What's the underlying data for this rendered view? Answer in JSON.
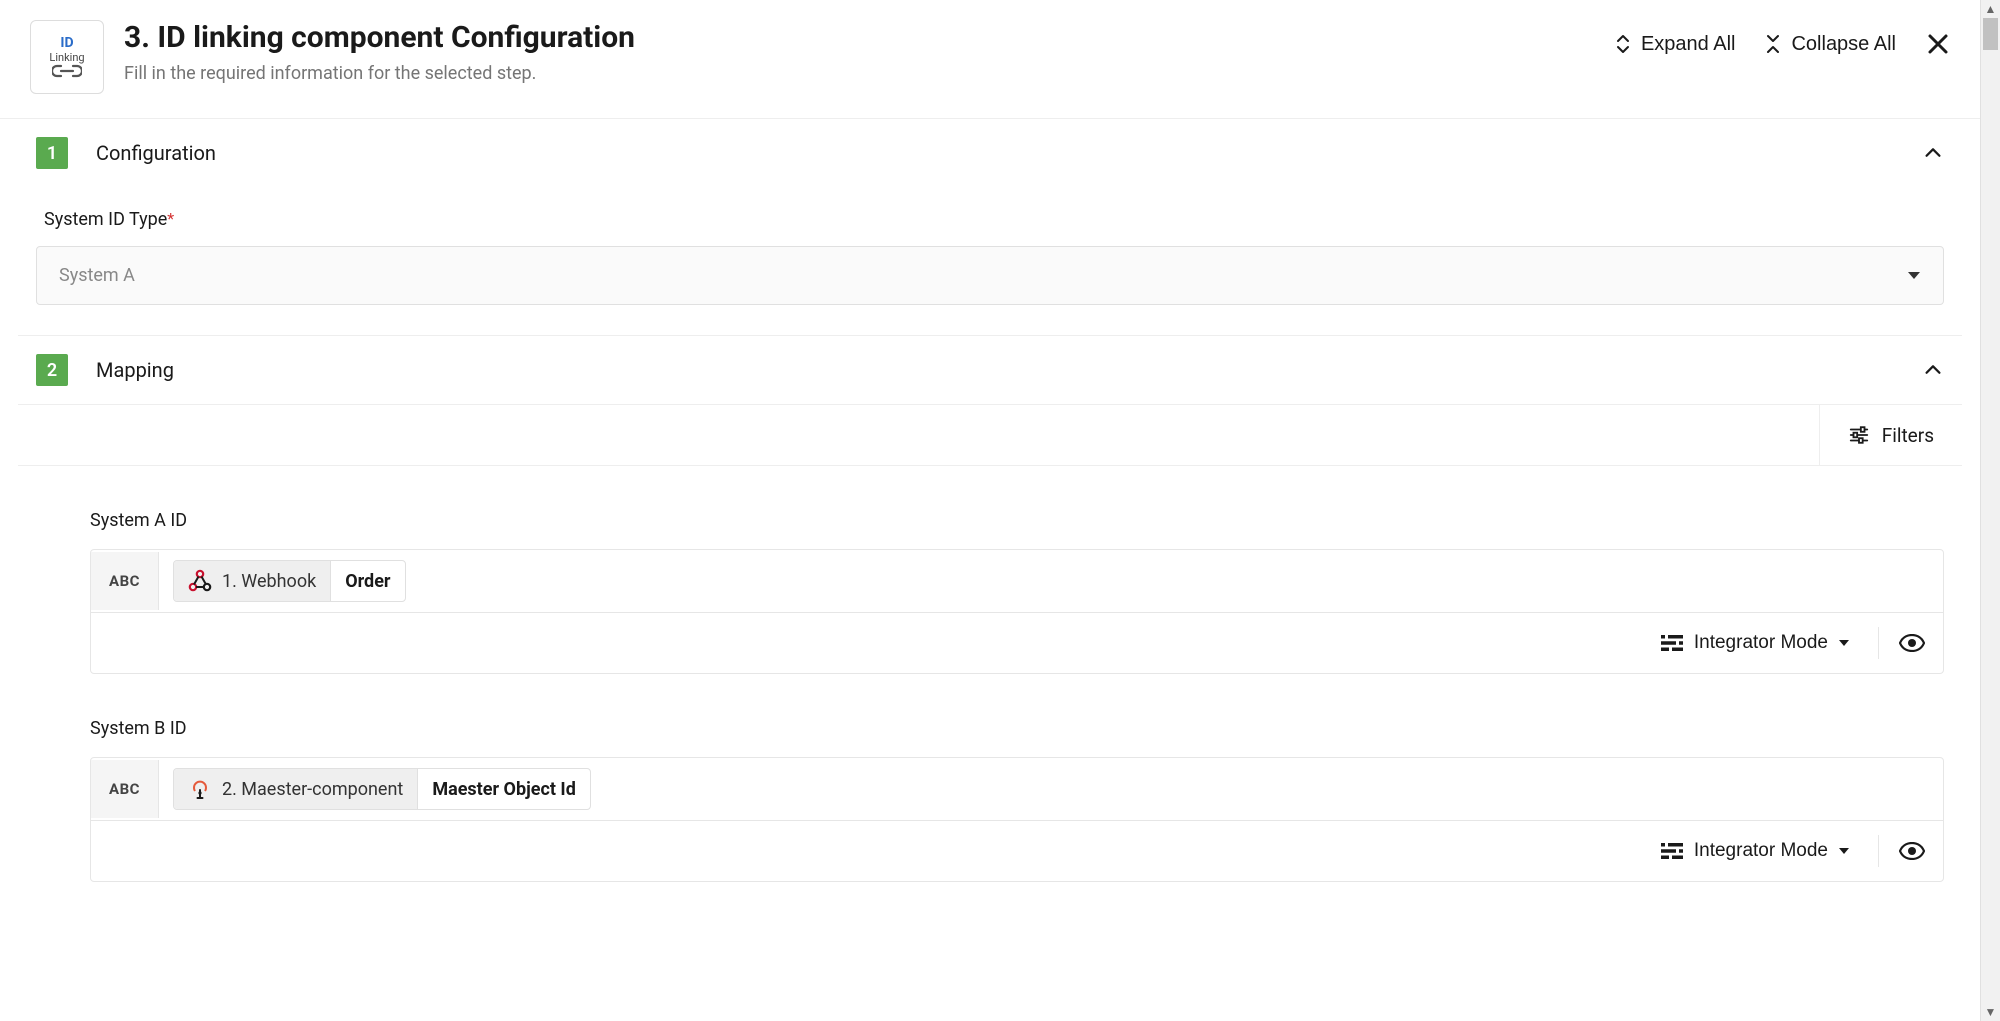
{
  "header": {
    "title": "3. ID linking component Configuration",
    "subtitle": "Fill in the required information for the selected step.",
    "icon_line1": "ID",
    "icon_line2": "Linking",
    "expand_all": "Expand All",
    "collapse_all": "Collapse All"
  },
  "sections": {
    "configuration": {
      "number": "1",
      "title": "Configuration",
      "system_id_type_label": "System ID Type",
      "system_id_type_value": "System A"
    },
    "mapping": {
      "number": "2",
      "title": "Mapping",
      "filters_label": "Filters",
      "abc": "ABC",
      "integrator_mode": "Integrator Mode",
      "system_a": {
        "label": "System A ID",
        "source": "1. Webhook",
        "value": "Order"
      },
      "system_b": {
        "label": "System B ID",
        "source": "2. Maester-component",
        "value": "Maester Object Id"
      }
    }
  }
}
